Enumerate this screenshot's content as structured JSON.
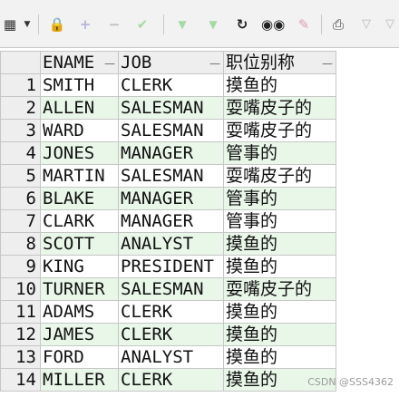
{
  "toolbar": {
    "icons": [
      "grid-dropdown-icon",
      "lock-icon",
      "add-record-icon",
      "delete-record-icon",
      "post-changes-icon",
      "fetch-next-page-icon",
      "fetch-all-icon",
      "refresh-icon",
      "find-icon",
      "clear-icon",
      "print-icon",
      "filter-icon"
    ]
  },
  "grid": {
    "headers": [
      "ENAME",
      "JOB",
      "职位别称"
    ],
    "rows": [
      {
        "num": "1",
        "ename": "SMITH",
        "job": "CLERK",
        "alias": "摸鱼的"
      },
      {
        "num": "2",
        "ename": "ALLEN",
        "job": "SALESMAN",
        "alias": "耍嘴皮子的"
      },
      {
        "num": "3",
        "ename": "WARD",
        "job": "SALESMAN",
        "alias": "耍嘴皮子的"
      },
      {
        "num": "4",
        "ename": "JONES",
        "job": "MANAGER",
        "alias": "管事的"
      },
      {
        "num": "5",
        "ename": "MARTIN",
        "job": "SALESMAN",
        "alias": "耍嘴皮子的"
      },
      {
        "num": "6",
        "ename": "BLAKE",
        "job": "MANAGER",
        "alias": "管事的"
      },
      {
        "num": "7",
        "ename": "CLARK",
        "job": "MANAGER",
        "alias": "管事的"
      },
      {
        "num": "8",
        "ename": "SCOTT",
        "job": "ANALYST",
        "alias": "摸鱼的"
      },
      {
        "num": "9",
        "ename": "KING",
        "job": "PRESIDENT",
        "alias": "摸鱼的"
      },
      {
        "num": "10",
        "ename": "TURNER",
        "job": "SALESMAN",
        "alias": "耍嘴皮子的"
      },
      {
        "num": "11",
        "ename": "ADAMS",
        "job": "CLERK",
        "alias": "摸鱼的"
      },
      {
        "num": "12",
        "ename": "JAMES",
        "job": "CLERK",
        "alias": "摸鱼的"
      },
      {
        "num": "13",
        "ename": "FORD",
        "job": "ANALYST",
        "alias": "摸鱼的"
      },
      {
        "num": "14",
        "ename": "MILLER",
        "job": "CLERK",
        "alias": "摸鱼的"
      }
    ]
  },
  "watermark": "CSDN @SSS4362",
  "colors": {
    "alt_row": "#e9f7e9",
    "toolbar_bg": "#f2f2f2",
    "header_bg": "#eeeeee"
  }
}
